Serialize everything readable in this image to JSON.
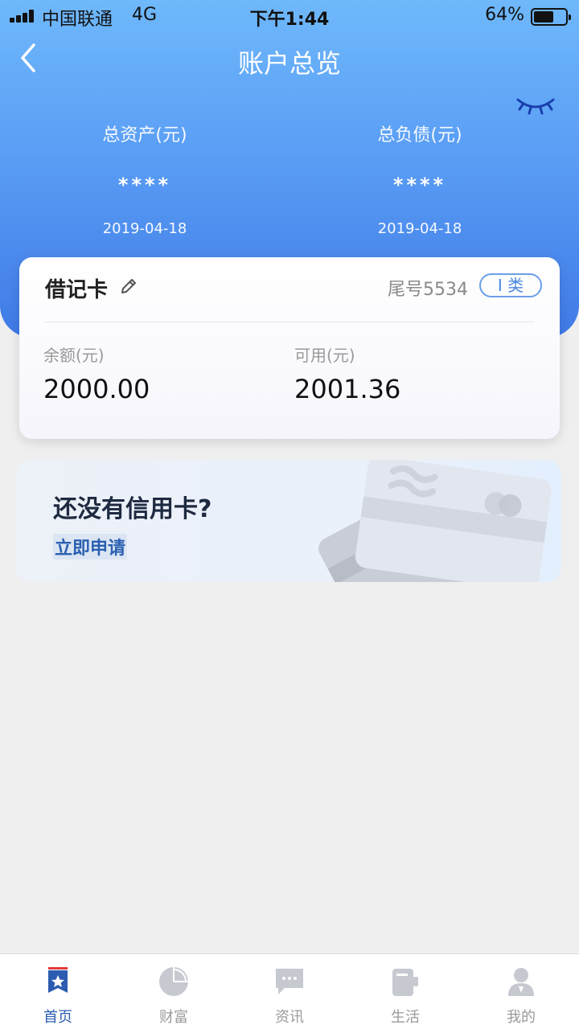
{
  "status_bar": {
    "carrier": "中国联通",
    "network": "4G",
    "time": "下午1:44",
    "battery_percent": "64%",
    "battery_level": 0.64
  },
  "nav": {
    "title": "账户总览",
    "back_icon": "chevron-left-icon",
    "eye_icon": "eye-closed-icon"
  },
  "summary": {
    "assets": {
      "label": "总资产(元)",
      "value": "****",
      "date": "2019-04-18"
    },
    "liabilities": {
      "label": "总负债(元)",
      "value": "****",
      "date": "2019-04-18"
    }
  },
  "debit_card": {
    "title": "借记卡",
    "edit_icon": "pencil-icon",
    "tail": "尾号5534",
    "type_badge": "I 类",
    "balance_label": "余额(元)",
    "balance_value": "2000.00",
    "available_label": "可用(元)",
    "available_value": "2001.36"
  },
  "credit_promo": {
    "title": "还没有信用卡?",
    "link": "立即申请"
  },
  "tabbar": {
    "items": [
      {
        "label": "首页",
        "icon": "home-star-icon",
        "active": true
      },
      {
        "label": "财富",
        "icon": "pie-chart-icon",
        "active": false
      },
      {
        "label": "资讯",
        "icon": "message-icon",
        "active": false
      },
      {
        "label": "生活",
        "icon": "cup-icon",
        "active": false
      },
      {
        "label": "我的",
        "icon": "user-icon",
        "active": false
      }
    ]
  },
  "colors": {
    "header_top": "#6fb8fb",
    "header_bottom": "#3f7ae6",
    "accent": "#2b5cb0",
    "badge_border": "#6a9fe8"
  }
}
